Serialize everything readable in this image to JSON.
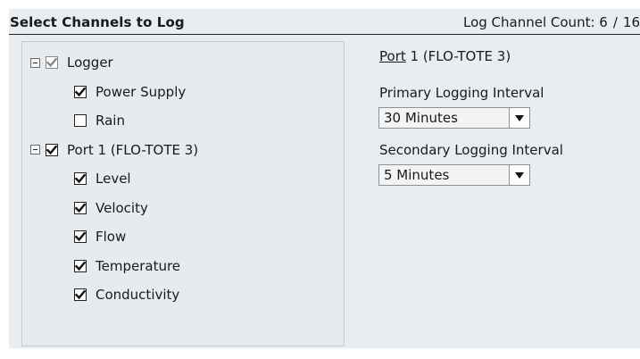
{
  "header": {
    "title": "Select Channels to Log",
    "count_label": "Log Channel Count:",
    "count_value": "6",
    "count_sep": "/",
    "count_max": "16"
  },
  "tree": {
    "groups": [
      {
        "label": "Logger",
        "checked": true,
        "dimmed": true,
        "children": [
          {
            "label": "Power Supply",
            "checked": true
          },
          {
            "label": "Rain",
            "checked": false
          }
        ]
      },
      {
        "label": "Port 1 (FLO-TOTE 3)",
        "checked": true,
        "dimmed": false,
        "children": [
          {
            "label": "Level",
            "checked": true
          },
          {
            "label": "Velocity",
            "checked": true
          },
          {
            "label": "Flow",
            "checked": true
          },
          {
            "label": "Temperature",
            "checked": true
          },
          {
            "label": "Conductivity",
            "checked": true
          }
        ]
      }
    ]
  },
  "detail": {
    "title_underlined": "Port",
    "title_rest": " 1 (FLO-TOTE 3)",
    "primary_label": "Primary Logging Interval",
    "primary_value": "30 Minutes",
    "secondary_label": "Secondary Logging Interval",
    "secondary_value": "5 Minutes"
  },
  "colors": {
    "panel": "#e8edf1",
    "check": "#111111",
    "check_dim": "#8a8a8a"
  },
  "icons": {
    "expander": "collapse-minus-icon",
    "dropdown": "dropdown-arrow-icon",
    "checkbox": "checkbox-checked-icon"
  }
}
